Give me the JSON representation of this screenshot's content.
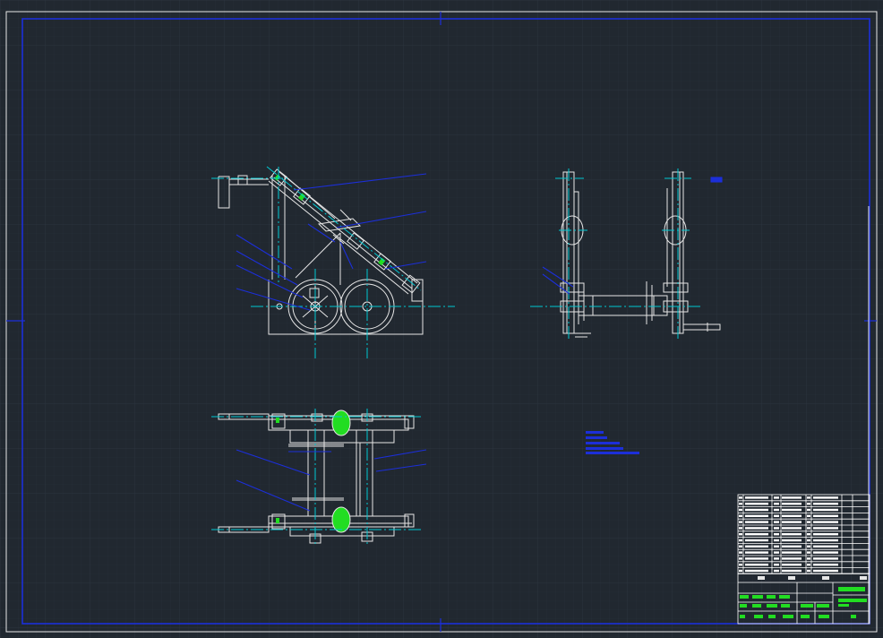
{
  "colors": {
    "background": "#212830",
    "grid_minor": "#283039",
    "grid_major": "#2d3540",
    "frame": "#e8e8e8",
    "part_line": "#e6e6e6",
    "center_line": "#00c8d2",
    "leader_line": "#1c2fd9",
    "highlight_fill": "#22dd22",
    "table_line": "#ffffff"
  },
  "icons": {
    "view_origin_marker": "crosshair-tick-icon"
  }
}
